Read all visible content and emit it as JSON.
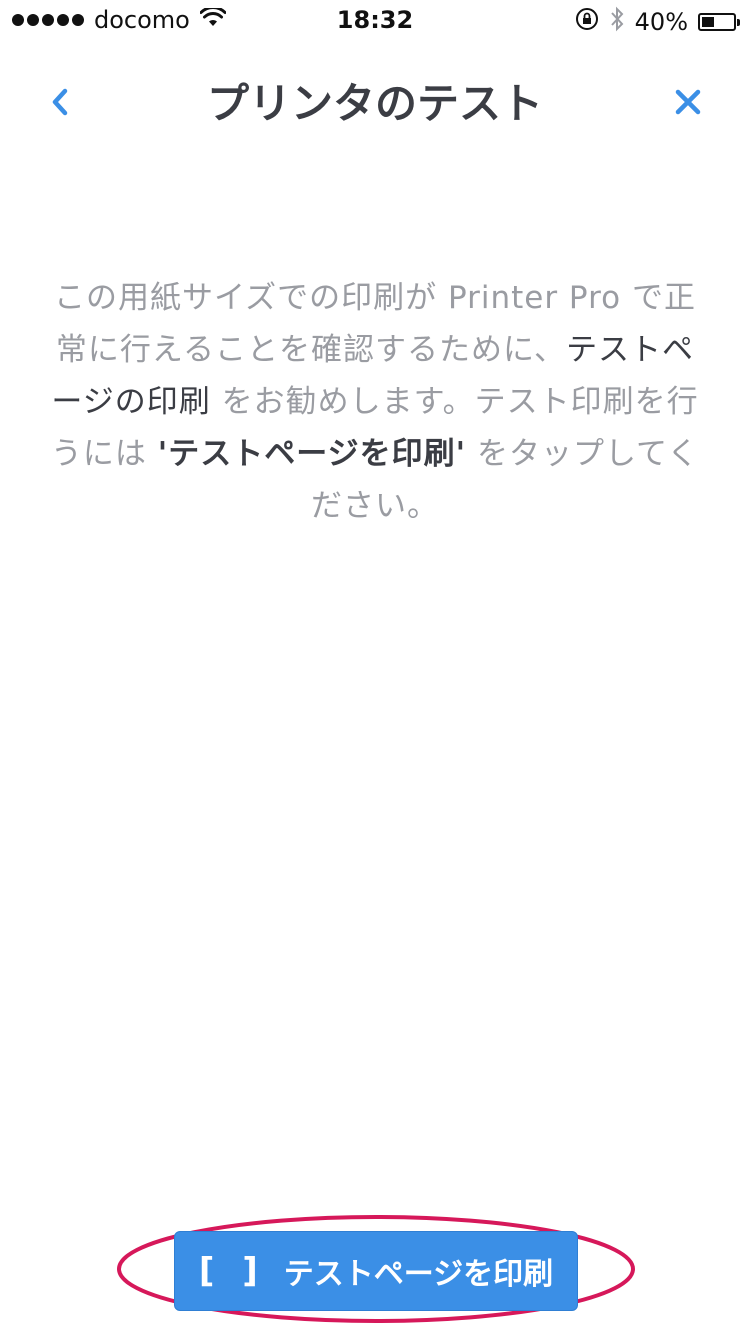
{
  "status_bar": {
    "carrier": "docomo",
    "time": "18:32",
    "battery_text": "40%",
    "battery_level": 0.4,
    "icons": [
      "signal-dots-icon",
      "wifi-icon",
      "rotation-lock-icon",
      "bluetooth-icon",
      "battery-icon"
    ]
  },
  "nav": {
    "title": "プリンタのテスト",
    "back_icon": "chevron-left-icon",
    "close_icon": "close-icon",
    "accent_color": "#3b8fe6"
  },
  "description": {
    "part1": "この用紙サイズでの印刷が Printer Pro で正常に行えることを確認するために、",
    "part2_dark": "テストページの印刷",
    "part3": " をお勧めします。テスト印刷を行うには ",
    "part4_bold": "'テストページを印刷'",
    "part5": " をタップしてください。"
  },
  "print_button": {
    "icon": "[ ]",
    "label": "テストページを印刷",
    "color": "#3b8fe6"
  },
  "annotation": {
    "ellipse_color": "#d6185a"
  }
}
